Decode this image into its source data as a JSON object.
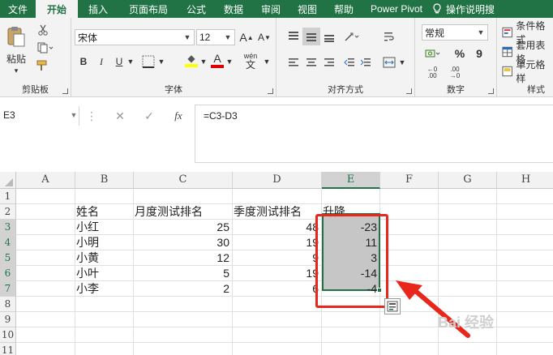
{
  "tabs": [
    "文件",
    "开始",
    "插入",
    "页面布局",
    "公式",
    "数据",
    "审阅",
    "视图",
    "帮助",
    "Power Pivot",
    "操作说明搜"
  ],
  "active_tab": "开始",
  "clipboard": {
    "paste_label": "粘贴",
    "group_label": "剪贴板"
  },
  "font": {
    "name": "宋体",
    "size": "12",
    "bold": "B",
    "italic": "I",
    "underline": "U",
    "grow": "A",
    "shrink": "A",
    "group_label": "字体",
    "fill_glyph": "◆",
    "font_color_glyph": "A",
    "phonetic": "wén"
  },
  "alignment": {
    "group_label": "对齐方式"
  },
  "number": {
    "format": "常规",
    "group_label": "数字",
    "percent": "%",
    "comma": "9"
  },
  "styles": {
    "conditional": "条件格式",
    "table": "套用表格",
    "cell": "单元格样",
    "group_label": "样式"
  },
  "formula_bar": {
    "name_box": "E3",
    "formula": "=C3-D3",
    "cancel": "✕",
    "enter": "✓",
    "fx": "fx"
  },
  "columns": [
    "A",
    "B",
    "C",
    "D",
    "E",
    "F",
    "G",
    "H"
  ],
  "rows": [
    "1",
    "2",
    "3",
    "4",
    "5",
    "6",
    "7",
    "8",
    "9",
    "10",
    "11"
  ],
  "headers": {
    "name": "姓名",
    "monthly": "月度测试排名",
    "season": "季度测试排名",
    "change": "升降"
  },
  "records": [
    {
      "name": "小红",
      "monthly": "25",
      "season": "48",
      "change": "-23"
    },
    {
      "name": "小明",
      "monthly": "30",
      "season": "19",
      "change": "11"
    },
    {
      "name": "小黄",
      "monthly": "12",
      "season": "9",
      "change": "3"
    },
    {
      "name": "小叶",
      "monthly": "5",
      "season": "19",
      "change": "-14"
    },
    {
      "name": "小李",
      "monthly": "2",
      "season": "6",
      "change": "-4"
    }
  ],
  "watermark": "Bai 经验",
  "colors": {
    "accent": "#217346",
    "annotation": "#e8261c",
    "selection_fill": "#c6c6c6"
  }
}
